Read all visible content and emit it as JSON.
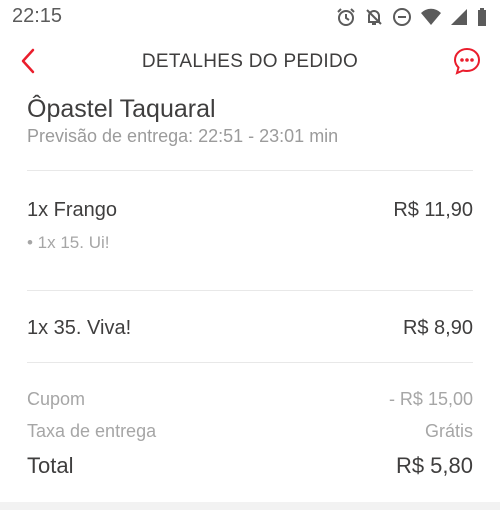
{
  "status_bar": {
    "time": "22:15",
    "icons": [
      "alarm-icon",
      "notifications-off-icon",
      "do-not-disturb-icon",
      "wifi-icon",
      "signal-icon",
      "battery-icon"
    ]
  },
  "header": {
    "title": "DETALHES DO PEDIDO",
    "back_icon": "chevron-left-icon",
    "chat_icon": "chat-bubble-icon",
    "accent_color": "#ea1d2c"
  },
  "order": {
    "store_name": "Ôpastel Taquaral",
    "delivery_estimate": "Previsão de entrega: 22:51 - 23:01 min",
    "items": [
      {
        "name": "1x Frango",
        "price": "R$  11,90",
        "subitem": "• 1x 15. Ui!"
      },
      {
        "name": "1x 35. Viva!",
        "price": "R$  8,90"
      }
    ],
    "summary": {
      "coupon_label": "Cupom",
      "coupon_value": "- R$  15,00",
      "delivery_fee_label": "Taxa de entrega",
      "delivery_fee_value": "Grátis",
      "total_label": "Total",
      "total_value": "R$  5,80"
    }
  }
}
